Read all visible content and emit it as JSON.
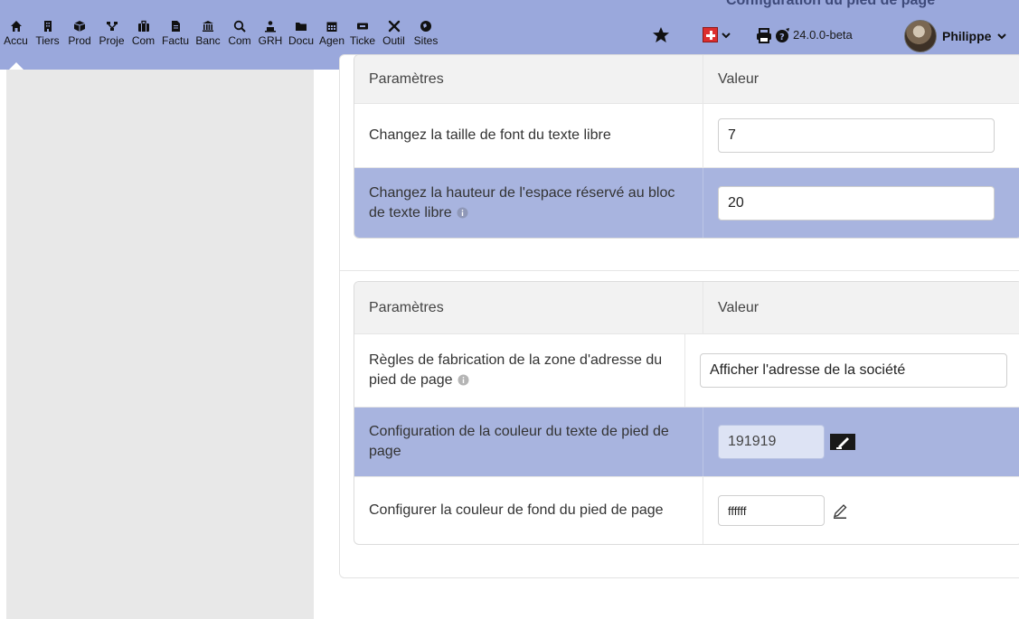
{
  "topbar": {
    "nav": [
      {
        "label": "Accu",
        "icon": "home-icon",
        "active": true
      },
      {
        "label": "Tiers",
        "icon": "building-icon"
      },
      {
        "label": "Prod",
        "icon": "cube-icon"
      },
      {
        "label": "Proje",
        "icon": "project-icon"
      },
      {
        "label": "Com",
        "icon": "suitcase-icon"
      },
      {
        "label": "Factu",
        "icon": "invoice-icon"
      },
      {
        "label": "Banc",
        "icon": "bank-icon"
      },
      {
        "label": "Com",
        "icon": "search-dollar-icon"
      },
      {
        "label": "GRH",
        "icon": "people-icon"
      },
      {
        "label": "Docu",
        "icon": "folder-icon"
      },
      {
        "label": "Agen",
        "icon": "calendar-icon"
      },
      {
        "label": "Ticke",
        "icon": "ticket-icon"
      },
      {
        "label": "Outil",
        "icon": "tools-icon"
      },
      {
        "label": "Sites",
        "icon": "globe-icon"
      }
    ],
    "cut_title": "Configuration du pied de page",
    "version": "24.0.0-beta",
    "user_name": "Philippe",
    "accent_color": "#9aa8dc"
  },
  "section1": {
    "header": {
      "param": "Paramètres",
      "value": "Valeur"
    },
    "rows": [
      {
        "label": "Changez la taille de font du texte libre",
        "value": "7"
      },
      {
        "label": "Changez la hauteur de l'espace réservé au bloc de texte libre",
        "value": "20"
      }
    ]
  },
  "section2": {
    "header": {
      "param": "Paramètres",
      "value": "Valeur"
    },
    "rows": [
      {
        "label": "Règles de fabrication de la zone d'adresse du pied de page",
        "value": "Afficher l'adresse de la société"
      },
      {
        "label": "Configuration de la couleur du texte de pied de page",
        "value": "191919"
      },
      {
        "label": "Configurer la couleur de fond du pied de page",
        "value": "ffffff"
      }
    ]
  },
  "colors": {
    "highlight_row": "#a8b4df",
    "text_color_swatch": "#191919",
    "background_color_swatch": "#ffffff"
  }
}
